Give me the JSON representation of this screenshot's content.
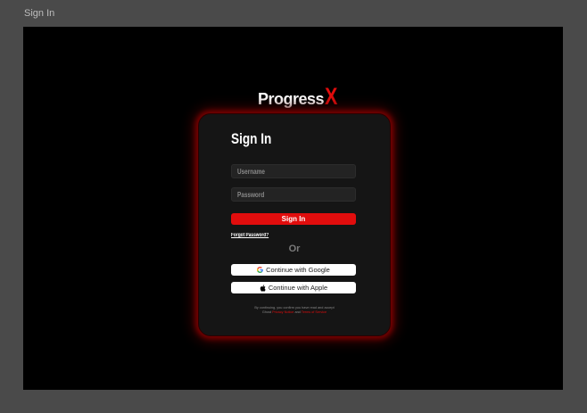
{
  "window": {
    "title": "Sign In"
  },
  "brand": {
    "name_main": "Progress",
    "name_accent": "X",
    "accent_color": "#e10d0d"
  },
  "form": {
    "title": "Sign In",
    "username_placeholder": "Username",
    "password_placeholder": "Password",
    "signin_label": "Sign In",
    "forgot_label": "Forgot Password?",
    "or_label": "Or"
  },
  "sso": {
    "google_label": "Continue with Google",
    "google_icon": "google-icon",
    "apple_label": "Continue with Apple",
    "apple_icon": "apple-icon"
  },
  "legal": {
    "line1": "By continuing, you confirm you have read and accept",
    "prefix": "Ghost",
    "privacy_link": "Privacy Notice",
    "and": "and",
    "terms_link": "Terms of Service"
  }
}
